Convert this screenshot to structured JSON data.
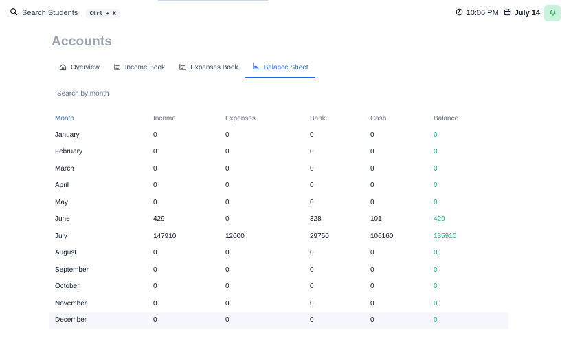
{
  "header": {
    "search_label": "Search Students",
    "shortcut": "Ctrl + K",
    "time": "10:06 PM",
    "date": "July 14"
  },
  "page": {
    "title": "Accounts",
    "tabs": [
      {
        "label": "Overview",
        "icon": "home-icon"
      },
      {
        "label": "Income Book",
        "icon": "chart-icon"
      },
      {
        "label": "Expenses Book",
        "icon": "chart-icon"
      },
      {
        "label": "Balance Sheet",
        "icon": "chart-icon",
        "active": true
      }
    ],
    "search_placeholder": "Search by month"
  },
  "table": {
    "columns": [
      "Month",
      "Income",
      "Expenses",
      "Bank",
      "Cash",
      "Balance"
    ],
    "rows": [
      [
        "January",
        "0",
        "0",
        "0",
        "0",
        "0"
      ],
      [
        "February",
        "0",
        "0",
        "0",
        "0",
        "0"
      ],
      [
        "March",
        "0",
        "0",
        "0",
        "0",
        "0"
      ],
      [
        "April",
        "0",
        "0",
        "0",
        "0",
        "0"
      ],
      [
        "May",
        "0",
        "0",
        "0",
        "0",
        "0"
      ],
      [
        "June",
        "429",
        "0",
        "328",
        "101",
        "429"
      ],
      [
        "July",
        "147910",
        "12000",
        "29750",
        "106160",
        "135910"
      ],
      [
        "August",
        "0",
        "0",
        "0",
        "0",
        "0"
      ],
      [
        "September",
        "0",
        "0",
        "0",
        "0",
        "0"
      ],
      [
        "October",
        "0",
        "0",
        "0",
        "0",
        "0"
      ],
      [
        "November",
        "0",
        "0",
        "0",
        "0",
        "0"
      ],
      [
        "December",
        "0",
        "0",
        "0",
        "0",
        "0"
      ]
    ]
  },
  "colors": {
    "accent": "#2563eb",
    "balance": "#10b981",
    "bell_bg": "#c9f2dc"
  }
}
